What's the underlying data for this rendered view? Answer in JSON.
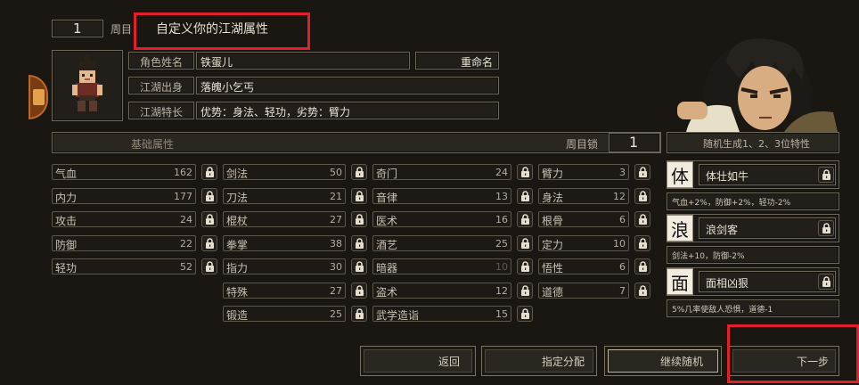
{
  "header": {
    "cycle_number": "1",
    "cycle_label": "周目",
    "title": "自定义你的江湖属性"
  },
  "profile": {
    "name_label": "角色姓名",
    "name_value": "铁蛋儿",
    "rename_button": "重命名",
    "origin_label": "江湖出身",
    "origin_value": "落魄小乞丐",
    "specialty_label": "江湖特长",
    "specialty_value": "优势：身法、轻功，劣势：臂力"
  },
  "basic": {
    "title": "基础属性",
    "cycle_lock_label": "周目锁",
    "cycle_lock_value": "1"
  },
  "attributes": {
    "col1": [
      {
        "name": "气血",
        "value": "162"
      },
      {
        "name": "内力",
        "value": "177"
      },
      {
        "name": "攻击",
        "value": "24"
      },
      {
        "name": "防御",
        "value": "22"
      },
      {
        "name": "轻功",
        "value": "52"
      }
    ],
    "col2": [
      {
        "name": "剑法",
        "value": "50"
      },
      {
        "name": "刀法",
        "value": "21"
      },
      {
        "name": "棍杖",
        "value": "27"
      },
      {
        "name": "拳掌",
        "value": "38"
      },
      {
        "name": "指力",
        "value": "30"
      },
      {
        "name": "特殊",
        "value": "27"
      },
      {
        "name": "锻造",
        "value": "25"
      }
    ],
    "col3": [
      {
        "name": "奇门",
        "value": "24"
      },
      {
        "name": "音律",
        "value": "13"
      },
      {
        "name": "医术",
        "value": "16"
      },
      {
        "name": "酒艺",
        "value": "25"
      },
      {
        "name": "暗器",
        "value": "10"
      },
      {
        "name": "盗术",
        "value": "12"
      },
      {
        "name": "武学造诣",
        "value": "15"
      }
    ],
    "col4": [
      {
        "name": "臂力",
        "value": "3"
      },
      {
        "name": "身法",
        "value": "12"
      },
      {
        "name": "根骨",
        "value": "6"
      },
      {
        "name": "定力",
        "value": "10"
      },
      {
        "name": "悟性",
        "value": "6"
      },
      {
        "name": "道德",
        "value": "7"
      }
    ]
  },
  "traits": {
    "header": "随机生成1、2、3位特性",
    "items": [
      {
        "glyph": "体",
        "name": "体壮如牛",
        "desc": "气血+2%，防御+2%，轻功-2%"
      },
      {
        "glyph": "浪",
        "name": "浪剑客",
        "desc": "剑法+10，防御-2%"
      },
      {
        "glyph": "面",
        "name": "面相凶狠",
        "desc": "5%几率使敌人恐惧，道德-1"
      }
    ]
  },
  "buttons": {
    "back": "返回",
    "assign": "指定分配",
    "reroll": "继续随机",
    "next": "下一步"
  },
  "colors": {
    "accent_red": "#e0202a",
    "background": "#1a1713",
    "frame": "#6d665a"
  }
}
